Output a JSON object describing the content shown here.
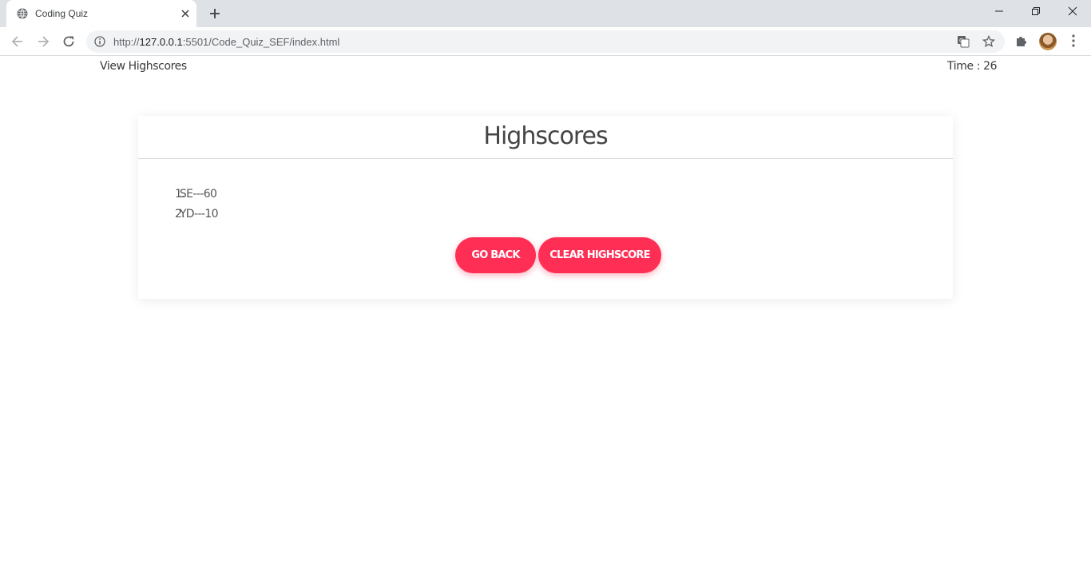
{
  "browser": {
    "tab_title": "Coding Quiz",
    "url_prefix": "http://",
    "url_host": "127.0.0.1",
    "url_rest": ":5501/Code_Quiz_SEF/index.html"
  },
  "header": {
    "view_highscores": "View Highscores",
    "timer_label": "Time",
    "timer_separator": " : ",
    "timer_value": "26"
  },
  "card": {
    "title": "Highscores",
    "scores": [
      {
        "rank": "1.",
        "entry": "SE---60"
      },
      {
        "rank": "2.",
        "entry": "YD---10"
      }
    ],
    "go_back_label": "Go Back",
    "clear_label": "Clear Highscore"
  },
  "colors": {
    "accent": "#ff2e55",
    "chrome_tabstrip": "#dee1e6",
    "omnibox": "#f1f3f4"
  },
  "icons": [
    "globe-icon",
    "close-icon",
    "plus-icon",
    "minimize-icon",
    "restore-icon",
    "window-close-icon",
    "back-arrow-icon",
    "forward-arrow-icon",
    "reload-icon",
    "info-icon",
    "translate-icon",
    "star-icon",
    "puzzle-icon",
    "kebab-menu-icon"
  ]
}
